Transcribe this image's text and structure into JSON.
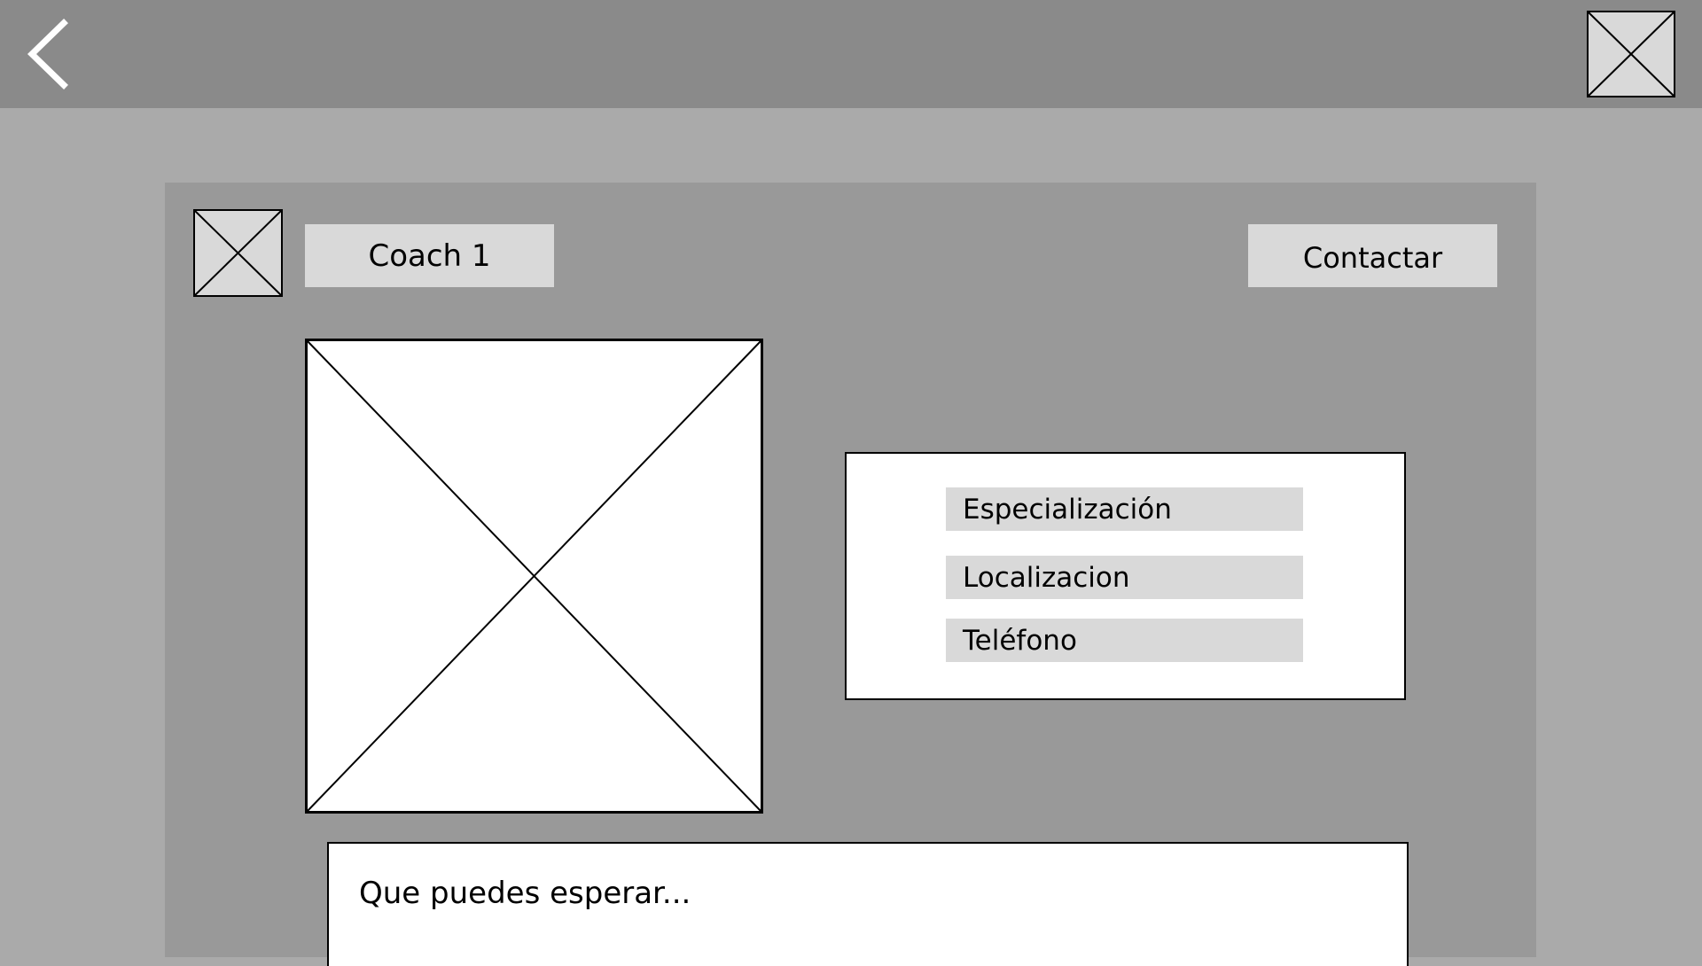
{
  "header": {
    "back_icon": "chevron-left-icon",
    "right_image_icon": "image-placeholder-icon"
  },
  "profile": {
    "coach_name": "Coach 1",
    "contact_label": "Contactar",
    "avatar_icon": "image-placeholder-icon",
    "photo_icon": "image-placeholder-icon"
  },
  "info": {
    "specialization": "Especialización",
    "location": "Localizacion",
    "phone": "Teléfono"
  },
  "description": {
    "text": "Que puedes esperar..."
  },
  "colors": {
    "topbar": "#8a8a8a",
    "page_background": "#aaaaaa",
    "card_background": "#999999",
    "label_background": "#d9d9d9",
    "panel_background": "#ffffff"
  }
}
